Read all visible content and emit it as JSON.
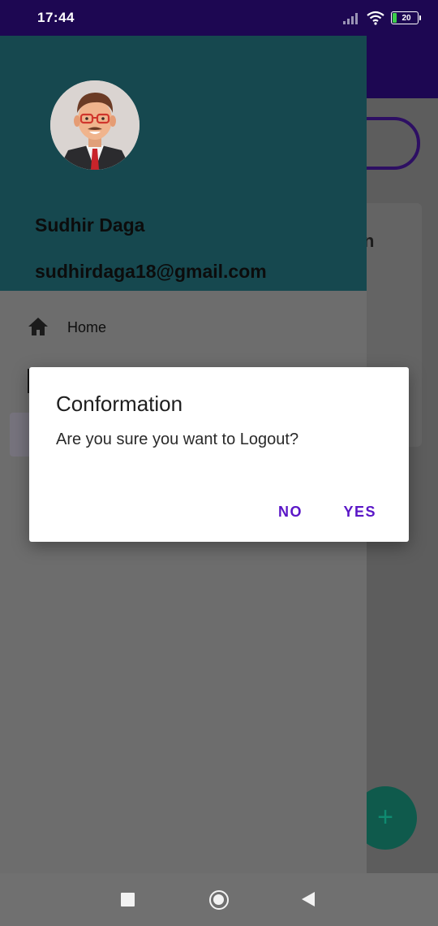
{
  "status_bar": {
    "time": "17:44",
    "battery_level": "20",
    "icons": [
      "signal-icon",
      "wifi-icon",
      "battery-icon"
    ]
  },
  "app": {
    "partial_card_text": "n",
    "fab_label": "+"
  },
  "drawer": {
    "user_name": "Sudhir Daga",
    "user_email": "sudhirdaga18@gmail.com",
    "items": [
      {
        "label": "Home",
        "icon": "home-icon"
      }
    ]
  },
  "dialog": {
    "title": "Conformation",
    "message": "Are you sure you want to Logout?",
    "negative_label": "NO",
    "positive_label": "YES"
  },
  "colors": {
    "status_bar": "#1d0752",
    "drawer_header": "#16484f",
    "dialog_button": "#5a16c7",
    "scrim": "#6b6b6b"
  }
}
